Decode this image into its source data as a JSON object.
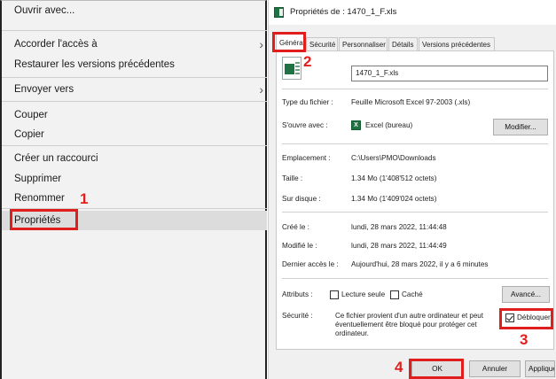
{
  "context_menu": {
    "items": [
      {
        "label": "Ouvrir avec..."
      },
      {
        "label": "Accorder l'accès à"
      },
      {
        "label": "Restaurer les versions précédentes"
      },
      {
        "label": "Envoyer vers"
      },
      {
        "label": "Couper"
      },
      {
        "label": "Copier"
      },
      {
        "label": "Créer un raccourci"
      },
      {
        "label": "Supprimer"
      },
      {
        "label": "Renommer"
      },
      {
        "label": "Propriétés"
      }
    ]
  },
  "dialog": {
    "title": "Propriétés de : 1470_1_F.xls",
    "tabs": [
      "Général",
      "Sécurité",
      "Personnaliser",
      "Détails",
      "Versions précédentes"
    ],
    "file_name": "1470_1_F.xls",
    "fields": {
      "type_label": "Type du fichier :",
      "type_value": "Feuille Microsoft Excel 97-2003 (.xls)",
      "opens_label": "S'ouvre avec :",
      "opens_value": "Excel (bureau)",
      "modify_button": "Modifier...",
      "location_label": "Emplacement :",
      "location_value": "C:\\Users\\PMO\\Downloads",
      "size_label": "Taille :",
      "size_value": "1.34 Mo (1'408'512 octets)",
      "disk_label": "Sur disque :",
      "disk_value": "1.34 Mo (1'409'024 octets)",
      "created_label": "Créé le :",
      "created_value": "lundi, 28 mars 2022, 11:44:48",
      "modified_label": "Modifié le :",
      "modified_value": "lundi, 28 mars 2022, 11:44:49",
      "accessed_label": "Dernier accès le :",
      "accessed_value": "Aujourd'hui, 28 mars 2022, il y a 6 minutes",
      "attributes_label": "Attributs :",
      "readonly_label": "Lecture seule",
      "hidden_label": "Caché",
      "advanced_button": "Avancé...",
      "security_label": "Sécurité :",
      "security_text": "Ce fichier provient d'un autre ordinateur et peut éventuellement être bloqué pour protéger cet ordinateur.",
      "unblock_label": "Débloquer"
    },
    "footer": {
      "ok": "OK",
      "cancel": "Annuler",
      "apply": "Appliquer"
    },
    "app_icon_letter": "X"
  },
  "annotations": {
    "step1": "1",
    "step2": "2",
    "step3": "3",
    "step4": "4",
    "color": "#e11e1e"
  }
}
